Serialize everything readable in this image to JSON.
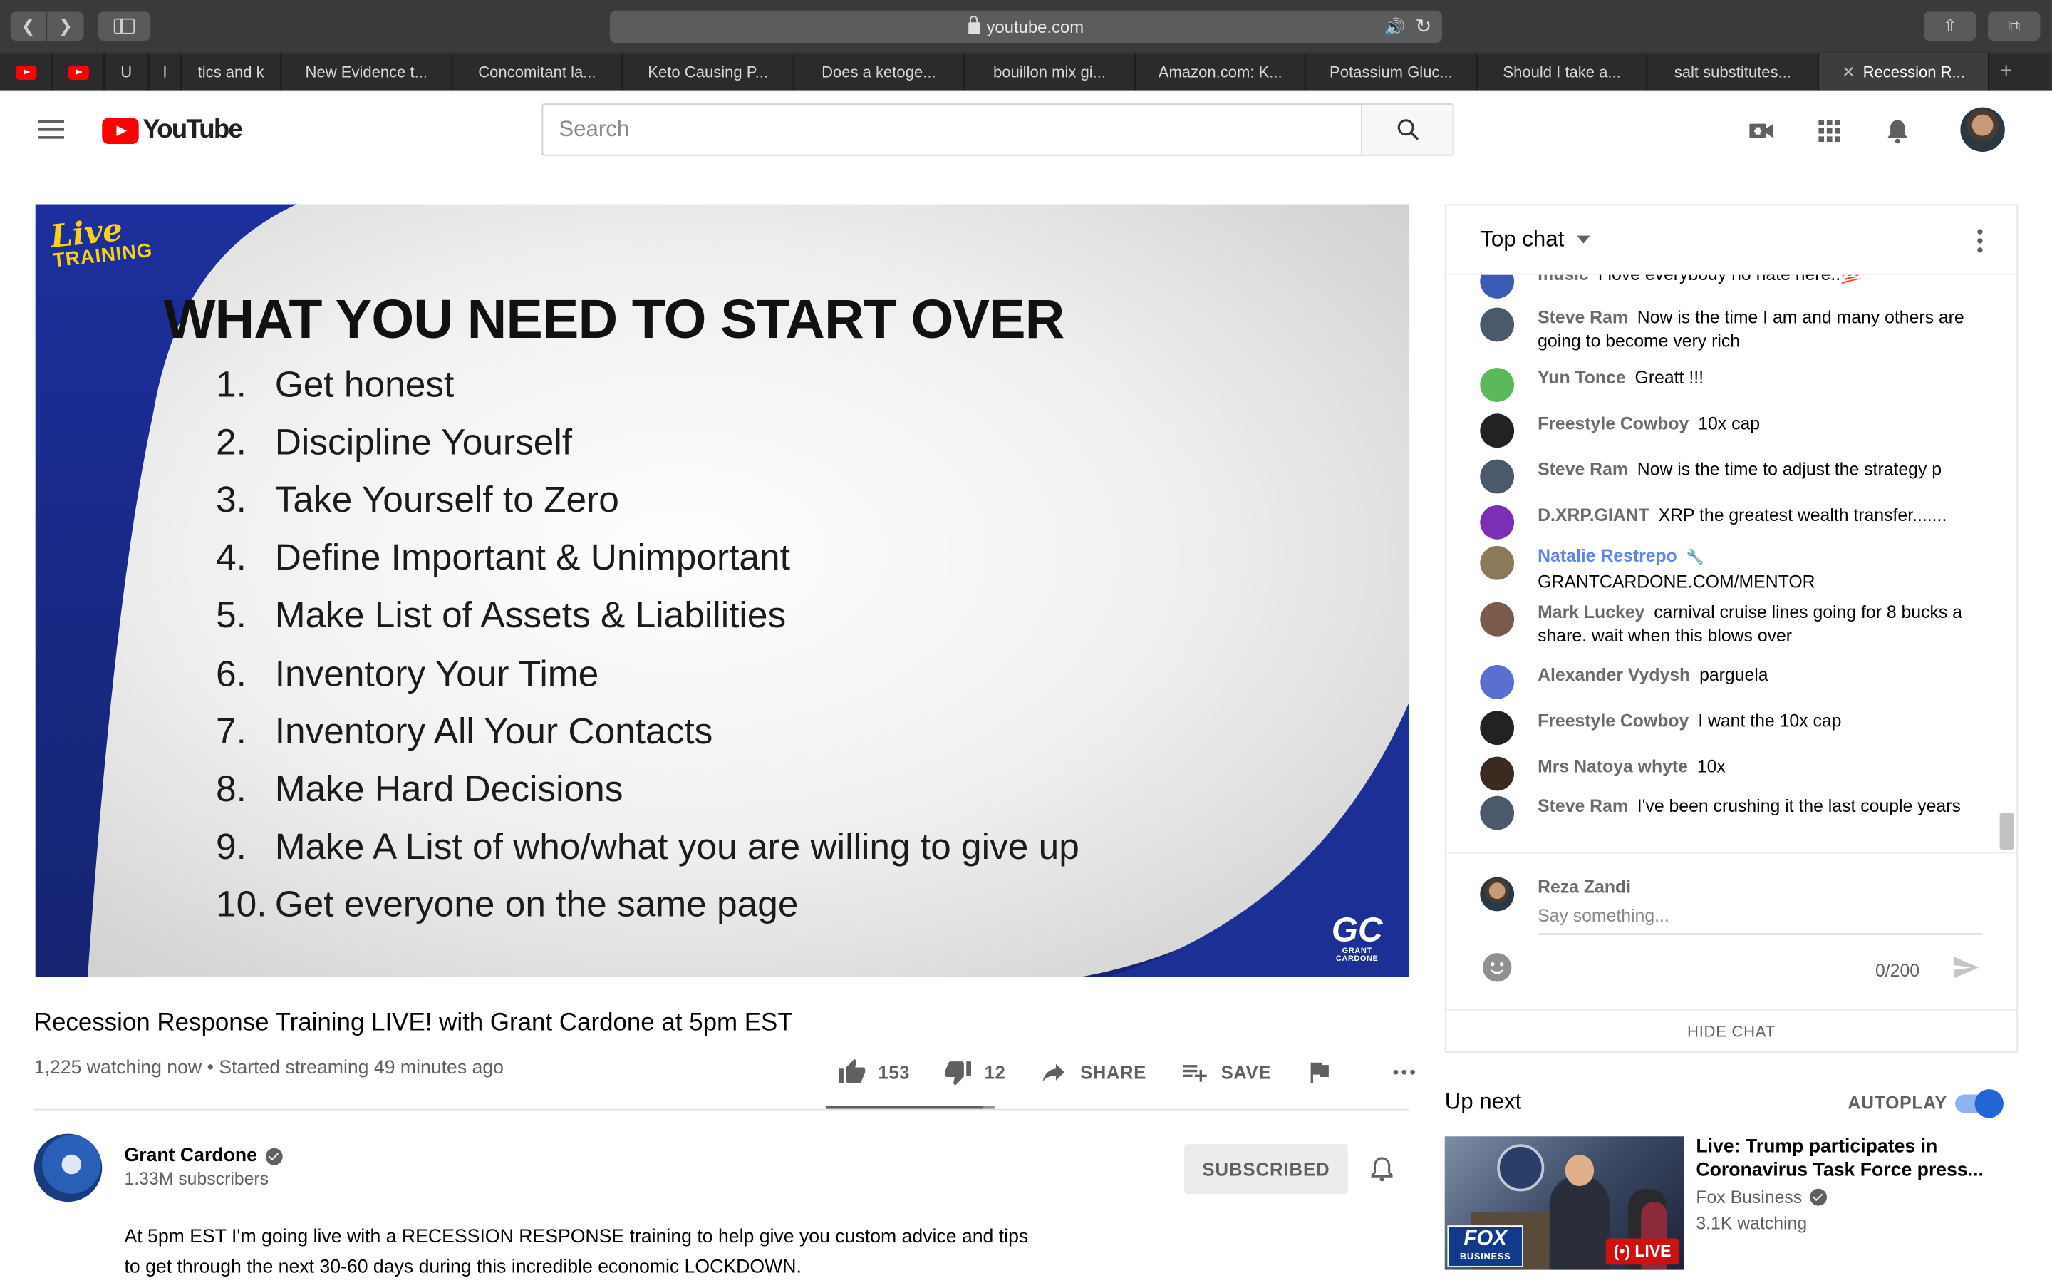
{
  "browser": {
    "address": "youtube.com",
    "tabs": [
      {
        "label": "",
        "pinned": true
      },
      {
        "label": "",
        "pinned": true
      },
      {
        "label": "U",
        "width": 34
      },
      {
        "label": "I",
        "width": 25
      },
      {
        "label": "tics and k",
        "width": 76
      },
      {
        "label": "New Evidence t...",
        "width": 131
      },
      {
        "label": "Concomitant la...",
        "width": 130
      },
      {
        "label": "Keto Causing P...",
        "width": 131
      },
      {
        "label": "Does a ketoge...",
        "width": 130
      },
      {
        "label": "bouillon mix gi...",
        "width": 131
      },
      {
        "label": "Amazon.com: K...",
        "width": 130
      },
      {
        "label": "Potassium Gluc...",
        "width": 131
      },
      {
        "label": "Should I take a...",
        "width": 130
      },
      {
        "label": "salt substitutes...",
        "width": 131
      },
      {
        "label": "Recession R...",
        "width": 130,
        "active": true
      }
    ]
  },
  "header": {
    "logo_text": "YouTube",
    "search_placeholder": "Search"
  },
  "slide": {
    "badge_top": "Live",
    "badge_bottom": "TRAINING",
    "title": "WHAT YOU NEED TO START OVER",
    "items": [
      {
        "num": "1.",
        "text": "Get honest"
      },
      {
        "num": "2.",
        "text": "Discipline Yourself"
      },
      {
        "num": "3.",
        "text": "Take Yourself to Zero"
      },
      {
        "num": "4.",
        "text": "Define Important & Unimportant"
      },
      {
        "num": "5.",
        "text": "Make List of Assets & Liabilities"
      },
      {
        "num": "6.",
        "text": "Inventory Your Time"
      },
      {
        "num": "7.",
        "text": "Inventory All Your Contacts"
      },
      {
        "num": "8.",
        "text": "Make Hard Decisions"
      },
      {
        "num": "9.",
        "text": "Make A List of who/what you are willing to give up"
      },
      {
        "num": "10.",
        "text": "Get everyone on the same page"
      }
    ],
    "logo_main": "GC",
    "logo_sub": "GRANT CARDONE"
  },
  "video": {
    "title": "Recession Response Training LIVE! with Grant Cardone at 5pm EST",
    "meta": "1,225 watching now • Started streaming 49 minutes ago",
    "likes": "153",
    "dislikes": "12",
    "share_label": "SHARE",
    "save_label": "SAVE",
    "like_ratio": 0.927
  },
  "channel": {
    "name": "Grant Cardone",
    "subscribers": "1.33M subscribers",
    "subscribe_label": "SUBSCRIBED",
    "description": "At 5pm EST I'm going live with a RECESSION RESPONSE training to help give you custom advice and tips to get through the next 30-60 days during this incredible economic LOCKDOWN."
  },
  "chat": {
    "header": "Top chat",
    "messages": [
      {
        "author": "music",
        "text": "I love everybody no hate here..💯",
        "color": "#3b5bb5"
      },
      {
        "author": "Steve Ram",
        "text": "Now is the time I am and many others are going to become very rich",
        "color": "#4a5a6a"
      },
      {
        "author": "Yun Tonce",
        "text": "Greatt !!!",
        "color": "#5bb85b"
      },
      {
        "author": "Freestyle Cowboy",
        "text": "10x cap",
        "color": "#222222"
      },
      {
        "author": "Steve Ram",
        "text": "Now is the time to adjust the strategy p",
        "color": "#4a5a6a"
      },
      {
        "author": "D.XRP.GIANT",
        "text": "XRP the greatest wealth transfer.......",
        "color": "#7b2fb5"
      },
      {
        "author": "Natalie Restrepo",
        "text": "GRANTCARDONE.COM/MENTOR",
        "color": "#8a7a5a",
        "moderator": true
      },
      {
        "author": "Mark Luckey",
        "text": "carnival cruise lines going for 8 bucks a share. wait when this blows over",
        "color": "#7a5a4a"
      },
      {
        "author": "Alexander Vydysh",
        "text": "parguela",
        "color": "#5b6fd1"
      },
      {
        "author": "Freestyle Cowboy",
        "text": "I want the 10x cap",
        "color": "#222222"
      },
      {
        "author": "Mrs Natoya whyte",
        "text": "10x",
        "color": "#3a2a20"
      },
      {
        "author": "Steve Ram",
        "text": "I've been crushing it the last couple years",
        "color": "#4a5a6a"
      }
    ],
    "current_user": "Reza Zandi",
    "input_placeholder": "Say something...",
    "counter": "0/200",
    "hide_label": "HIDE CHAT"
  },
  "upnext": {
    "heading": "Up next",
    "autoplay_label": "AUTOPLAY",
    "autoplay_on": true,
    "title": "Live: Trump participates in Coronavirus Task Force press...",
    "channel": "Fox Business",
    "watching": "3.1K watching",
    "live_badge": "LIVE",
    "thumb_logo_top": "FOX",
    "thumb_logo_bottom": "BUSINESS"
  }
}
